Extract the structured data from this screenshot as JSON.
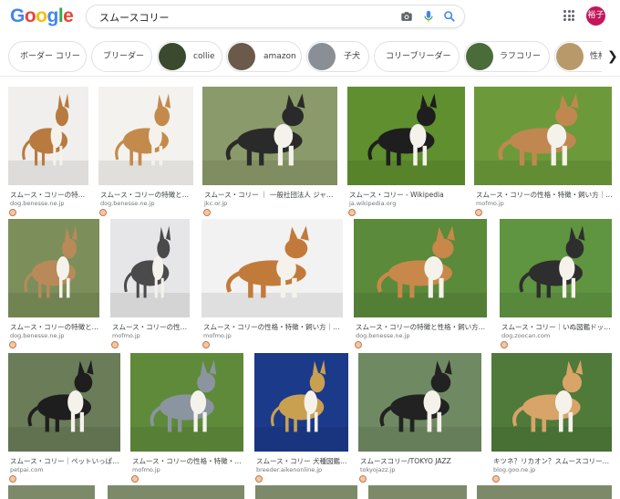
{
  "logo": {
    "text": [
      "G",
      "o",
      "o",
      "g",
      "l",
      "e"
    ],
    "colors": [
      "#4285f4",
      "#ea4335",
      "#fbbc05",
      "#4285f4",
      "#34a853",
      "#ea4335"
    ]
  },
  "search": {
    "query": "スムースコリー"
  },
  "avatar": {
    "label": "裕子",
    "color": "#c2185b"
  },
  "chips": [
    {
      "label": "ボーダー コリー",
      "thumb": ""
    },
    {
      "label": "ブリーダー",
      "thumb": ""
    },
    {
      "label": "collie",
      "thumb": "#3b4a2e"
    },
    {
      "label": "amazon",
      "thumb": "#6b5a4a"
    },
    {
      "label": "子犬",
      "thumb": "#8a8f95"
    },
    {
      "label": "コリーブリーダー",
      "thumb": ""
    },
    {
      "label": "ラフコリー",
      "thumb": "#4a6b3a"
    },
    {
      "label": "性格",
      "thumb": "#b89a6a"
    }
  ],
  "results": [
    {
      "title": "スムース・コリーの特…",
      "domain": "dog.benesse.ne.jp",
      "bg": "#f0efed",
      "dog": "#b87a3e"
    },
    {
      "title": "スムース・コリーの特徴と…",
      "domain": "dog.benesse.ne.jp",
      "bg": "#f4f2ef",
      "dog": "#c48a4c"
    },
    {
      "title": "スムース・コリー ｜ 一般社団法人 ジャ…",
      "domain": "jkc.or.jp",
      "bg": "#8a9a6a",
      "dog": "#2a2a2a"
    },
    {
      "title": "スムース・コリー - Wikipedia",
      "domain": "ja.wikipedia.org",
      "bg": "#5f8f2f",
      "dog": "#1e1e1e"
    },
    {
      "title": "スムース・コリーの性格・特徴・飼い方｜…",
      "domain": "mofmo.jp",
      "bg": "#6c9a3a",
      "dog": "#c08850"
    },
    {
      "title": "スムース・コリーの特徴と…",
      "domain": "dog.benesse.ne.jp",
      "bg": "#7c8f5a",
      "dog": "#b88a5a"
    },
    {
      "title": "スムース・コリーの性…",
      "domain": "mofmo.jp",
      "bg": "#e6e6e8",
      "dog": "#4a4a4a"
    },
    {
      "title": "スムース・コリーの性格・特徴・飼い方｜…",
      "domain": "mofmo.jp",
      "bg": "#f2f2f2",
      "dog": "#c27a3a"
    },
    {
      "title": "スムース・コリーの特徴と性格・飼い方…",
      "domain": "dog.benesse.ne.jp",
      "bg": "#5a8a3a",
      "dog": "#c8884a"
    },
    {
      "title": "スムース・コリー｜いぬ図鑑ドッ…",
      "domain": "dog.zoocan.com",
      "bg": "#5f9440",
      "dog": "#2e2e2e"
    },
    {
      "title": "スムース・コリー｜ペットいっぱ…",
      "domain": "petpai.com",
      "bg": "#6a7c58",
      "dog": "#1e1e1e"
    },
    {
      "title": "スムース・コリーの性格・特徴・…",
      "domain": "mofmo.jp",
      "bg": "#5f8a3a",
      "dog": "#8a95a0"
    },
    {
      "title": "スムース・コリー 犬種図鑑…",
      "domain": "breeder.aikenonline.jp",
      "bg": "#1c3a8a",
      "dog": "#c8a050"
    },
    {
      "title": "スムースコリー/TOKYO JAZZ",
      "domain": "tokyojazz.jp",
      "bg": "#6f8a62",
      "dog": "#222222"
    },
    {
      "title": "キツネ？リカオン？スムースコリー…",
      "domain": "blog.goo.ne.jp",
      "bg": "#4f7a3a",
      "dog": "#d8a468"
    }
  ]
}
